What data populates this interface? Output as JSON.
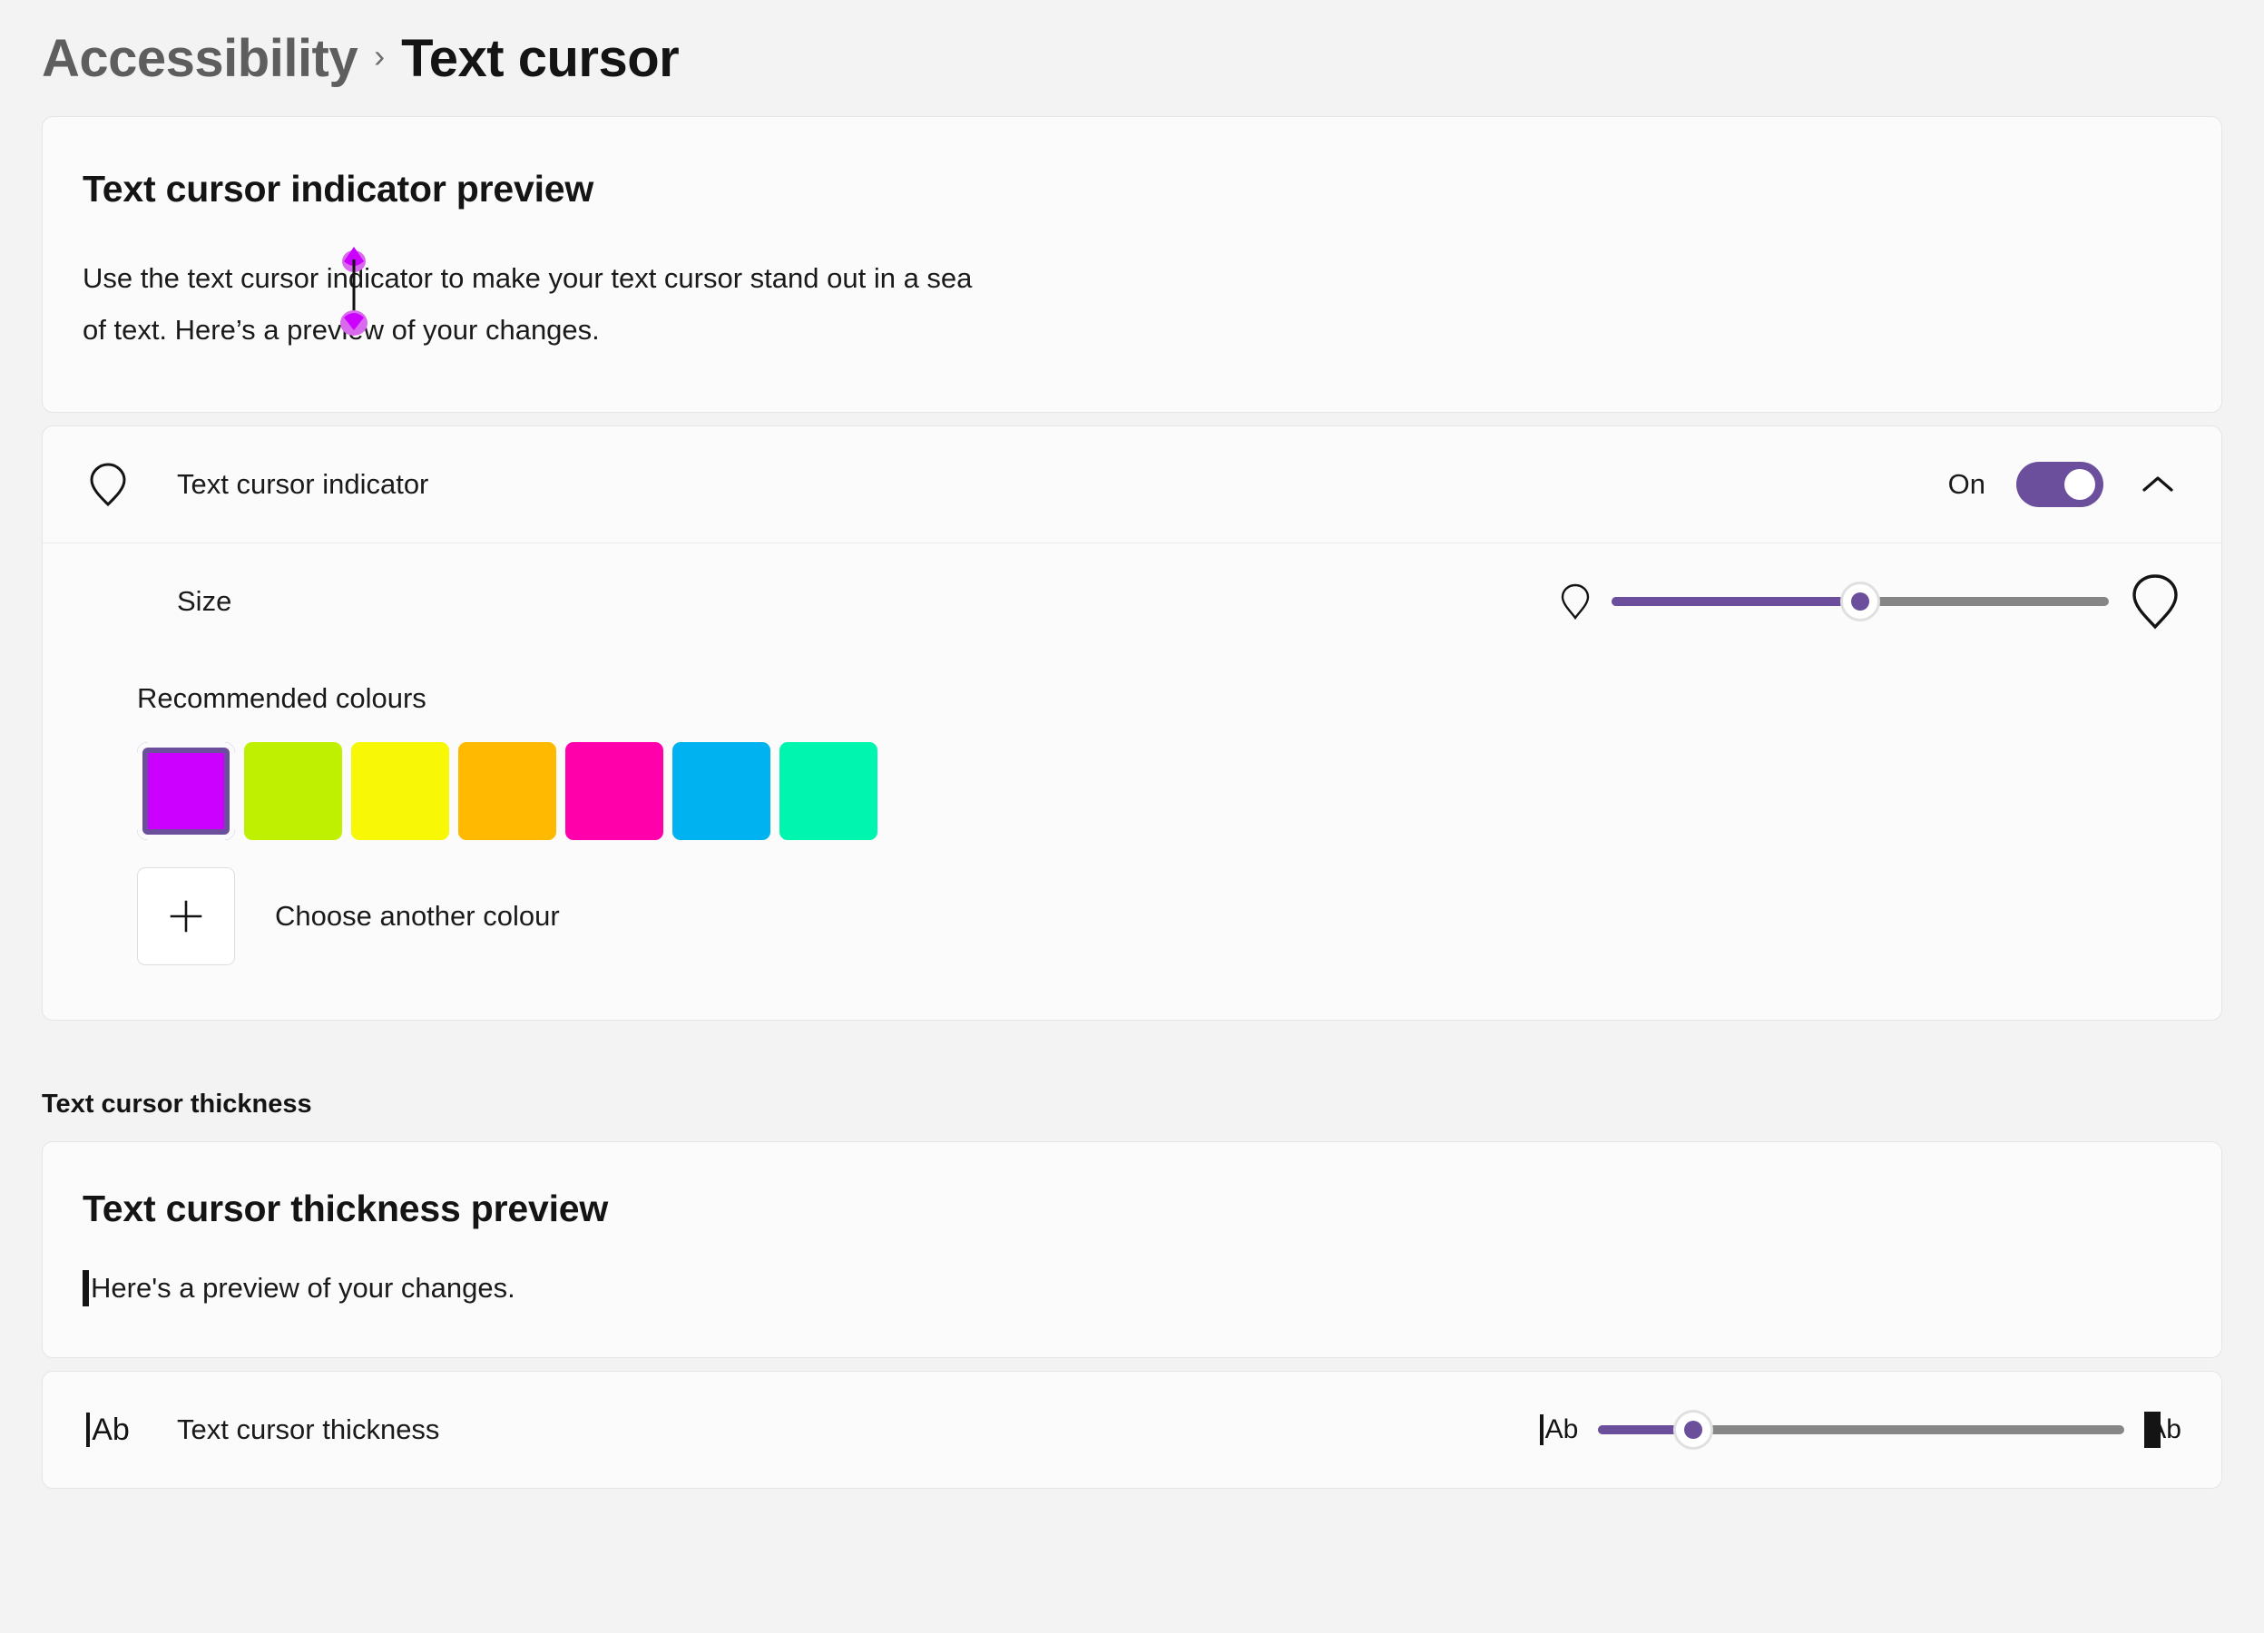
{
  "breadcrumb": {
    "parent": "Accessibility",
    "separator": "›",
    "current": "Text cursor"
  },
  "indicator_preview": {
    "title": "Text cursor indicator preview",
    "body_line1": "Use the text cursor indicator to make your text cursor stand out in a sea",
    "body_line2": "of text. Here’s a preview of your changes.",
    "indicator_color": "#CC00FF",
    "indicator_color_light": "#D96AEE"
  },
  "indicator_setting": {
    "icon": "cursor-pin-icon",
    "label": "Text cursor indicator",
    "state_label": "On",
    "state_on": true,
    "accent_color": "#6B4E9C",
    "expand_icon": "chevron-up-icon",
    "expanded": true
  },
  "size_setting": {
    "label": "Size",
    "min_icon": "small-pin-icon",
    "max_icon": "large-pin-icon",
    "value_percent": 50,
    "fill_color": "#6B4E9C",
    "track_color": "#868686"
  },
  "colours": {
    "title": "Recommended colours",
    "selected_index": 0,
    "swatches": [
      {
        "name": "magenta",
        "hex": "#CC00FF"
      },
      {
        "name": "chartreuse",
        "hex": "#BFF001"
      },
      {
        "name": "yellow",
        "hex": "#F7F706"
      },
      {
        "name": "orange",
        "hex": "#FFB900"
      },
      {
        "name": "pink",
        "hex": "#FF00AA"
      },
      {
        "name": "cyan",
        "hex": "#00B2F0"
      },
      {
        "name": "spring-green",
        "hex": "#00F5AE"
      }
    ],
    "choose_icon": "plus-icon",
    "choose_label": "Choose another colour"
  },
  "thickness_section": {
    "heading": "Text cursor thickness",
    "preview_title": "Text cursor thickness preview",
    "preview_body": "Here's a preview of your changes.",
    "setting_icon": "text-caret-ab-icon",
    "setting_label": "Text cursor thickness",
    "min_icon": "thin-caret-ab-icon",
    "max_icon": "thick-caret-ab-icon",
    "value_percent": 18,
    "fill_color": "#6B4E9C",
    "track_color": "#868686"
  }
}
